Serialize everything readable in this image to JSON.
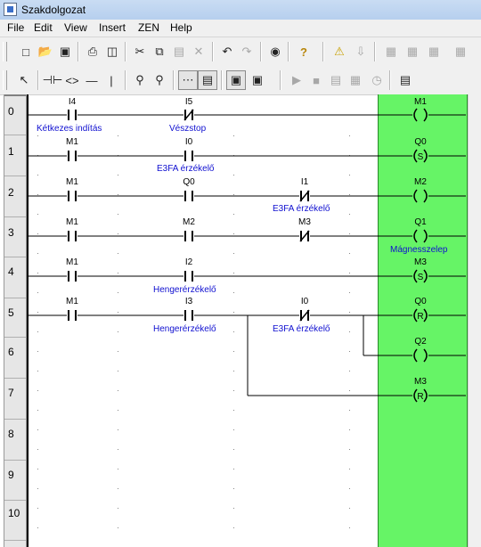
{
  "window": {
    "title": "Szakdolgozat"
  },
  "menu": [
    "File",
    "Edit",
    "View",
    "Insert",
    "ZEN",
    "Help"
  ],
  "toolbar1": [
    "new-icon",
    "open-icon",
    "save-icon",
    "print-icon",
    "print-preview-icon",
    "cut-icon",
    "copy-icon",
    "paste-icon",
    "delete-icon",
    "undo-icon",
    "redo-icon",
    "find-icon",
    "help-icon",
    "warning-icon",
    "download-icon",
    "program-icon",
    "transfer-icon",
    "compare-icon",
    "monitor-icon",
    "connect-icon"
  ],
  "toolbar2": [
    "select-icon",
    "contact-no-icon",
    "contact-nc-icon",
    "horizontal-line-icon",
    "vertical-line-icon",
    "zoom-in-icon",
    "zoom-out-icon",
    "grid-icon",
    "comment-icon",
    "online-icon",
    "offline-icon",
    "run-icon",
    "stop-icon",
    "monitor-mode-icon",
    "table-icon",
    "timer-icon",
    "settings-icon"
  ],
  "colors": {
    "coil_zone": "#66f466",
    "comment": "#1010d0",
    "rail": "#000000"
  },
  "rungs": [
    "0",
    "1",
    "2",
    "3",
    "4",
    "5",
    "6",
    "7",
    "8",
    "9",
    "10"
  ],
  "labels": {
    "r0c1": "I4",
    "r0c2": "I5",
    "r0coil": "M1",
    "r1c1": "M1",
    "r1c2": "I0",
    "r1coil": "Q0",
    "r2c1": "M1",
    "r2c2": "Q0",
    "r2c3": "I1",
    "r2coil": "M2",
    "r3c1": "M1",
    "r3c2": "M2",
    "r3c3": "M3",
    "r3coil": "Q1",
    "r4c1": "M1",
    "r4c2": "I2",
    "r4coil": "M3",
    "r5c1": "M1",
    "r5c2": "I3",
    "r5c3": "I0",
    "r5coil": "Q0",
    "r6coil": "Q2",
    "r7coil": "M3"
  },
  "comments": {
    "r0c1": "Kétkezes indítás",
    "r0c2": "Vészstop",
    "r1c2": "E3FA érzékelő",
    "r2c3": "E3FA érzékelő",
    "r3coil": "Mágnesszelep",
    "r4c2": "Hengerérzékelő",
    "r5c2": "Hengerérzékelő",
    "r5c3": "E3FA érzékelő"
  },
  "coil_types": {
    "r0": "( )",
    "r1": "(S)",
    "r2": "( )",
    "r3": "( )",
    "r4": "(S)",
    "r5": "(R)",
    "r6": "( )",
    "r7": "(R)"
  }
}
